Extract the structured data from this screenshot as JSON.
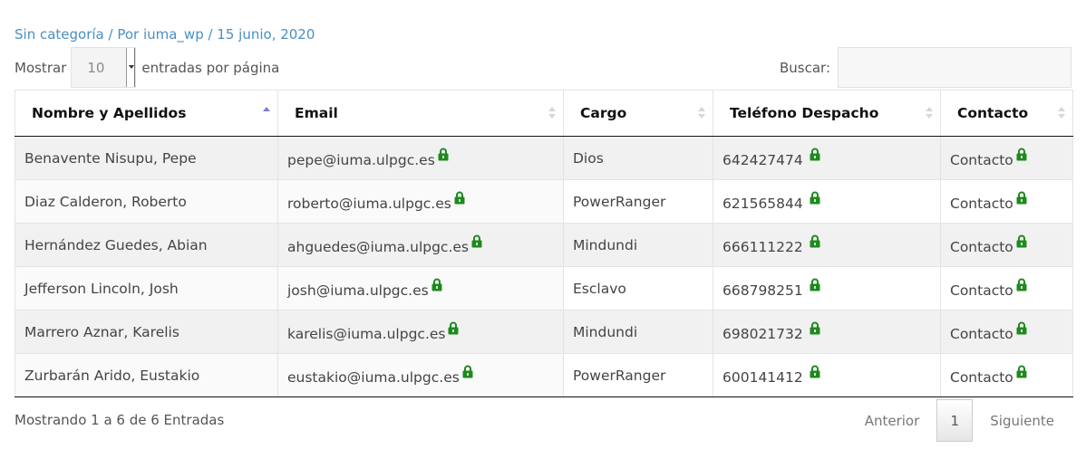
{
  "meta": {
    "text": "Sin categoría / Por iuma_wp / 15 junio, 2020"
  },
  "length_control": {
    "show_label": "Mostrar",
    "selected": "10",
    "suffix": "entradas por página"
  },
  "search": {
    "label": "Buscar:",
    "value": ""
  },
  "table": {
    "columns": [
      {
        "label": "Nombre y Apellidos",
        "sort": "asc"
      },
      {
        "label": "Email",
        "sort": "none"
      },
      {
        "label": "Cargo",
        "sort": "none"
      },
      {
        "label": "Teléfono Despacho",
        "sort": "none"
      },
      {
        "label": "Contacto",
        "sort": "none"
      }
    ],
    "rows": [
      {
        "name": "Benavente Nisupu, Pepe",
        "email": "pepe@iuma.ulpgc.es",
        "cargo": "Dios",
        "phone": "642427474",
        "contact": "Contacto"
      },
      {
        "name": "Diaz Calderon, Roberto",
        "email": "roberto@iuma.ulpgc.es",
        "cargo": "PowerRanger",
        "phone": "621565844",
        "contact": "Contacto"
      },
      {
        "name": "Hernández Guedes, Abian",
        "email": "ahguedes@iuma.ulpgc.es",
        "cargo": "Mindundi",
        "phone": "666111222",
        "contact": "Contacto"
      },
      {
        "name": "Jefferson Lincoln, Josh",
        "email": "josh@iuma.ulpgc.es",
        "cargo": "Esclavo",
        "phone": "668798251",
        "contact": "Contacto"
      },
      {
        "name": "Marrero Aznar, Karelis",
        "email": "karelis@iuma.ulpgc.es",
        "cargo": "Mindundi",
        "phone": "698021732",
        "contact": "Contacto"
      },
      {
        "name": "Zurbarán Arido, Eustakio",
        "email": "eustakio@iuma.ulpgc.es",
        "cargo": "PowerRanger",
        "phone": "600141412",
        "contact": "Contacto"
      }
    ]
  },
  "footer": {
    "info": "Mostrando 1 a 6 de 6 Entradas",
    "prev_label": "Anterior",
    "current_page": "1",
    "next_label": "Siguiente"
  },
  "colors": {
    "meta_link": "#4a8fc4",
    "lock_icon": "#1e8a1e",
    "sort_active": "#7c7fcf",
    "row_odd": "#f1f1f1"
  },
  "icons": {
    "lock": "lock-icon",
    "sort": "sort-icon",
    "select_arrow": "chevron-down-icon"
  }
}
